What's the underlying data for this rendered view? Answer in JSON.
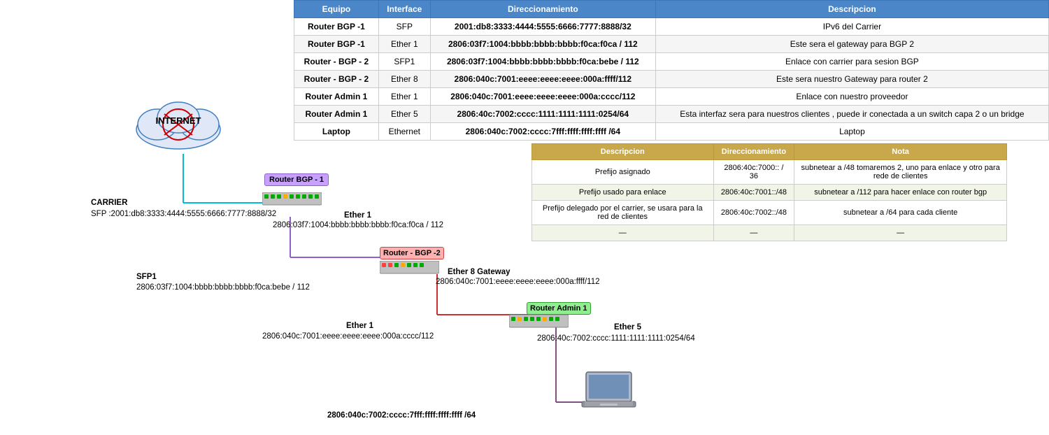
{
  "table": {
    "headers": [
      "Equipo",
      "Interface",
      "Direccionamiento",
      "Descripcion"
    ],
    "rows": [
      {
        "equipo": "Router BGP -1",
        "interface": "SFP",
        "direccionamiento": "2001:db8:3333:4444:5555:6666:7777:8888/32",
        "descripcion": "IPv6 del Carrier"
      },
      {
        "equipo": "Router BGP -1",
        "interface": "Ether 1",
        "direccionamiento": "2806:03f7:1004:bbbb:bbbb:bbbb:f0ca:f0ca / 112",
        "descripcion": "Este sera el gateway para BGP 2"
      },
      {
        "equipo": "Router - BGP - 2",
        "interface": "SFP1",
        "direccionamiento": "2806:03f7:1004:bbbb:bbbb:bbbb:f0ca:bebe / 112",
        "descripcion": "Enlace con carrier para sesion BGP"
      },
      {
        "equipo": "Router - BGP - 2",
        "interface": "Ether 8",
        "direccionamiento": "2806:040c:7001:eeee:eeee:eeee:000a:ffff/112",
        "descripcion": "Este sera nuestro Gateway para router 2"
      },
      {
        "equipo": "Router Admin 1",
        "interface": "Ether 1",
        "direccionamiento": "2806:040c:7001:eeee:eeee:eeee:000a:cccc/112",
        "descripcion": "Enlace con nuestro proveedor"
      },
      {
        "equipo": "Router Admin 1",
        "interface": "Ether 5",
        "direccionamiento": "2806:40c:7002:cccc:1111:1111:1111:0254/64",
        "descripcion": "Esta interfaz sera para nuestros clientes , puede ir conectada a un switch capa 2 o un bridge"
      },
      {
        "equipo": "Laptop",
        "interface": "Ethernet",
        "direccionamiento": "2806:040c:7002:cccc:7fff:ffff:ffff:ffff /64",
        "descripcion": "Laptop"
      }
    ]
  },
  "second_table": {
    "headers": [
      "Descripcion",
      "Direccionamiento",
      "Nota"
    ],
    "rows": [
      {
        "descripcion": "Prefijo asignado",
        "direccionamiento": "2806:40c:7000:: / 36",
        "nota": "subnetear a /48  tomaremos 2, uno para enlace y otro para rede de clientes"
      },
      {
        "descripcion": "Prefijo usado para enlace",
        "direccionamiento": "2806:40c:7001::/48",
        "nota": "subnetear a /112 para hacer enlace con router bgp"
      },
      {
        "descripcion": "Prefijo delegado por el carrier, se usara para la red de clientes",
        "direccionamiento": "2806:40c:7002::/48",
        "nota": "subnetear a /64 para cada cliente"
      },
      {
        "descripcion": "—",
        "direccionamiento": "—",
        "nota": "—"
      }
    ]
  },
  "diagram": {
    "internet_label": "INTERNET",
    "carrier_label": "CARRIER",
    "carrier_sfp": "SFP :2001:db8:3333:4444:5555:6666:7777:8888/32",
    "router_bgp1_label": "Router BGP -\n1",
    "router_bgp2_label": "Router - BGP -2",
    "router_admin1_label": "Router Admin 1",
    "ether1_bgp1_label": "Ether 1",
    "ether1_bgp1_addr": "2806:03f7:1004:bbbb:bbbb:bbbb:f0ca:f0ca / 112",
    "sfp1_bgp2_label": "SFP1",
    "sfp1_bgp2_addr": "2806:03f7:1004:bbbb:bbbb:bbbb:f0ca:bebe / 112",
    "ether8_gw_label": "Ether 8 Gateway",
    "ether8_gw_addr": "2806:040c:7001:eeee:eeee:eeee:000a:ffff/112",
    "ether1_admin_label": "Ether 1",
    "ether1_admin_addr": "2806:040c:7001:eeee:eeee:eeee:000a:cccc/112",
    "ether5_label": "Ether 5",
    "ether5_addr": "2806:40c:7002:cccc:1111:1111:1111:0254/64",
    "laptop_addr": "2806:040c:7002:cccc:7fff:ffff:ffff:ffff /64"
  }
}
